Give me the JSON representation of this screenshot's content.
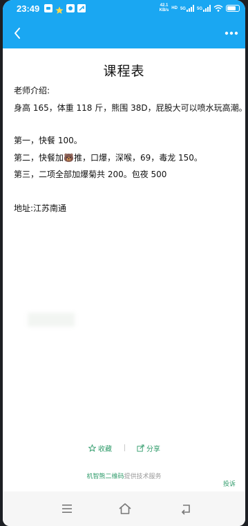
{
  "status_bar": {
    "time": "23:49",
    "left_icons": [
      "message-icon",
      "star-app-icon",
      "notification-icon",
      "app-icon"
    ],
    "speed_value": "42.1",
    "speed_unit": "KB/s",
    "hd_label": "HD",
    "sim1_label": "5G",
    "sim2_label": "5G",
    "wifi": "wifi-icon",
    "battery_level": 0.8
  },
  "toolbar": {
    "background": "#1aa7f2",
    "back_icon": "chevron-left-icon",
    "more_icon": "more-dots-icon"
  },
  "page": {
    "title": "课程表",
    "lines": [
      "老师介绍:",
      "身高 165，体重 118 斤，熊围 38D，屁股大可以喷水玩高潮。",
      "第一，快餐 100。",
      "第二，快餐加🐻推，口爆，深喉，69，毒龙 150。",
      "第三，二项全部加爆菊共 200。包夜 500",
      "地址:江苏南通"
    ]
  },
  "actions": {
    "favorite_label": "收藏",
    "share_label": "分享",
    "accent_color": "#2f9b6a"
  },
  "footer": {
    "provider_name": "机智熊二维码",
    "provider_suffix": "提供技术服务",
    "report_label": "投诉"
  },
  "nav": {
    "menu_icon": "menu-icon",
    "home_icon": "home-icon",
    "back_icon": "back-arrow-icon"
  }
}
